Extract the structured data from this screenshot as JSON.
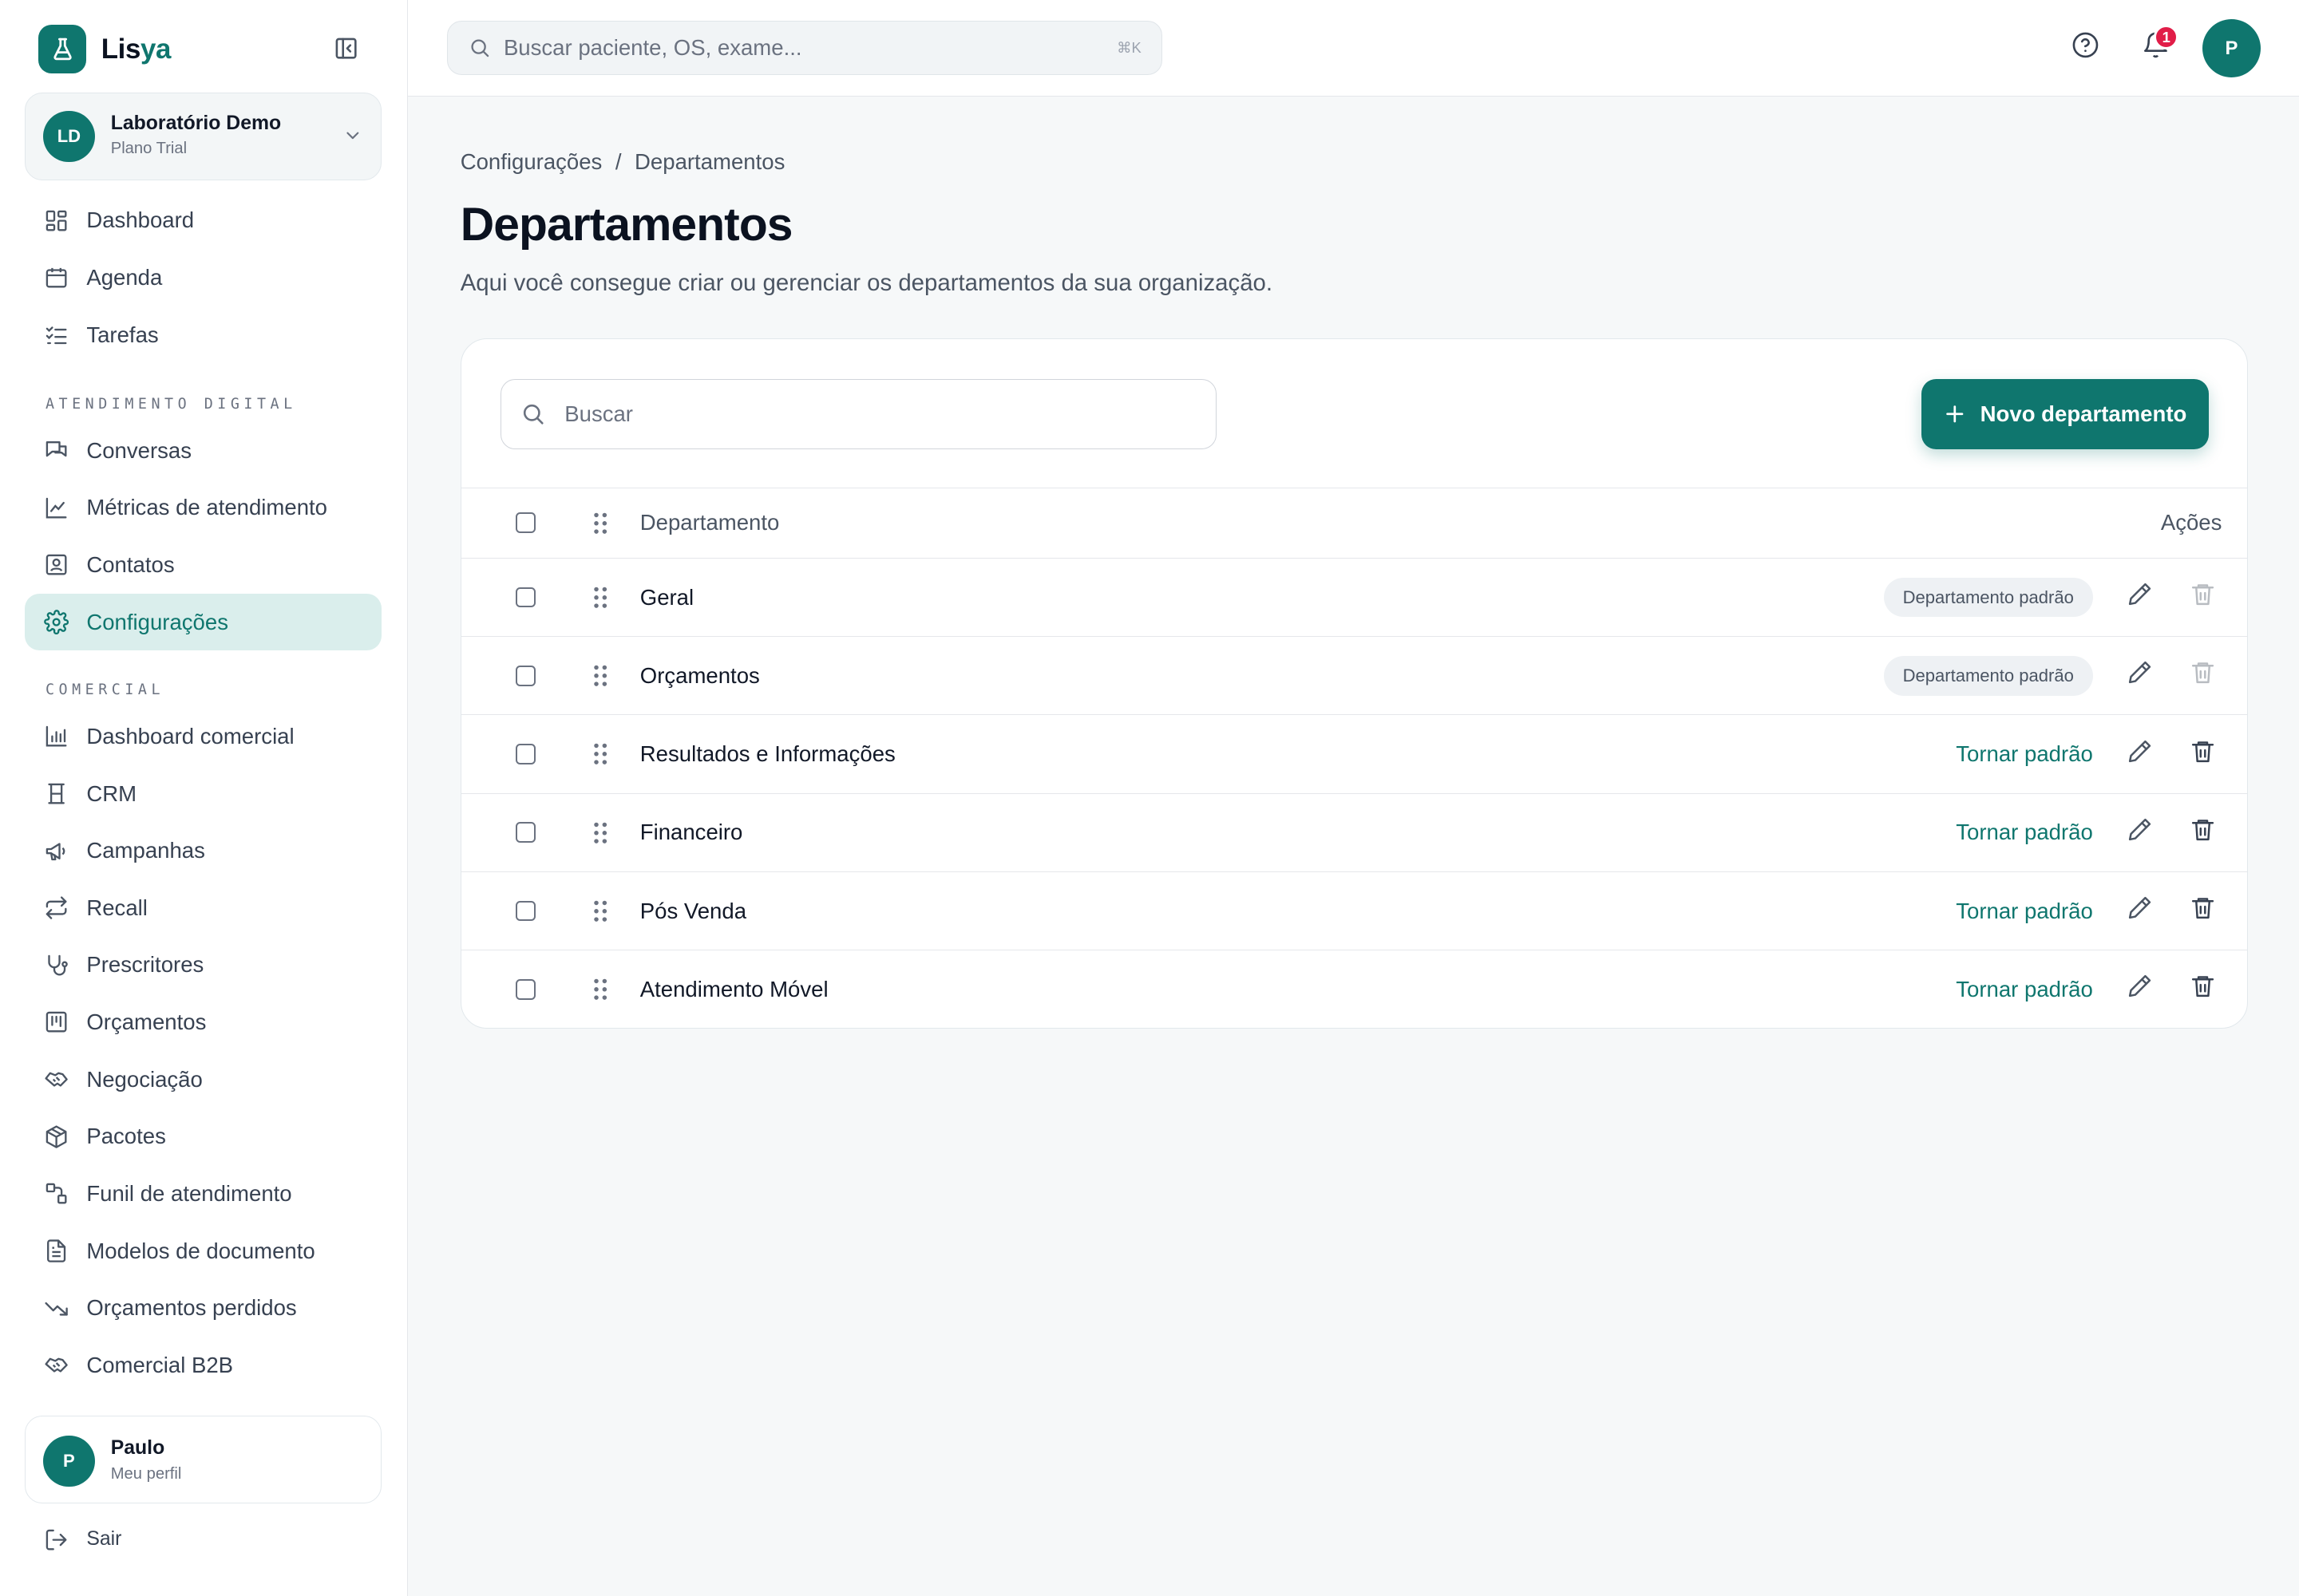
{
  "brand": {
    "name_part1": "Lis",
    "name_part2": "ya"
  },
  "org": {
    "initials": "LD",
    "name": "Laboratório Demo",
    "plan": "Plano Trial"
  },
  "sidebar": {
    "top_items": [
      {
        "label": "Dashboard",
        "icon": "dashboard-icon"
      },
      {
        "label": "Agenda",
        "icon": "calendar-icon"
      },
      {
        "label": "Tarefas",
        "icon": "task-list-icon"
      }
    ],
    "section_digital": "ATENDIMENTO DIGITAL",
    "digital_items": [
      {
        "label": "Conversas",
        "icon": "chat-icon"
      },
      {
        "label": "Métricas de atendimento",
        "icon": "line-chart-icon"
      },
      {
        "label": "Contatos",
        "icon": "contact-icon"
      },
      {
        "label": "Configurações",
        "icon": "gear-icon",
        "active": true
      }
    ],
    "section_comercial": "COMERCIAL",
    "comercial_items": [
      {
        "label": "Dashboard comercial",
        "icon": "bar-chart-icon"
      },
      {
        "label": "CRM",
        "icon": "crm-icon"
      },
      {
        "label": "Campanhas",
        "icon": "megaphone-icon"
      },
      {
        "label": "Recall",
        "icon": "repeat-icon"
      },
      {
        "label": "Prescritores",
        "icon": "stethoscope-icon"
      },
      {
        "label": "Orçamentos",
        "icon": "kanban-icon"
      },
      {
        "label": "Negociação",
        "icon": "handshake-icon"
      },
      {
        "label": "Pacotes",
        "icon": "package-icon"
      },
      {
        "label": "Funil de atendimento",
        "icon": "funnel-icon"
      },
      {
        "label": "Modelos de documento",
        "icon": "document-icon"
      },
      {
        "label": "Orçamentos perdidos",
        "icon": "trending-down-icon"
      },
      {
        "label": "Comercial B2B",
        "icon": "handshake-icon"
      }
    ]
  },
  "profile": {
    "initial": "P",
    "name": "Paulo",
    "sub": "Meu perfil"
  },
  "logout": {
    "label": "Sair"
  },
  "topbar": {
    "search_placeholder": "Buscar paciente, OS, exame...",
    "shortcut": "⌘K",
    "notifications_count": "1",
    "avatar_initial": "P"
  },
  "breadcrumb": {
    "parent": "Configurações",
    "separator": "/",
    "current": "Departamentos"
  },
  "page": {
    "title": "Departamentos",
    "description": "Aqui você consegue criar ou gerenciar os departamentos da sua organização."
  },
  "card": {
    "search_placeholder": "Buscar",
    "new_button": "Novo departamento",
    "col_department": "Departamento",
    "col_actions": "Ações",
    "default_badge": "Departamento padrão",
    "make_default": "Tornar padrão"
  },
  "departments": [
    {
      "name": "Geral",
      "is_default": true
    },
    {
      "name": "Orçamentos",
      "is_default": true
    },
    {
      "name": "Resultados e Informações",
      "is_default": false
    },
    {
      "name": "Financeiro",
      "is_default": false
    },
    {
      "name": "Pós Venda",
      "is_default": false
    },
    {
      "name": "Atendimento Móvel",
      "is_default": false
    }
  ],
  "colors": {
    "accent": "#0f766e",
    "active_bg": "#daeeec",
    "badge_red": "#e11d48"
  }
}
